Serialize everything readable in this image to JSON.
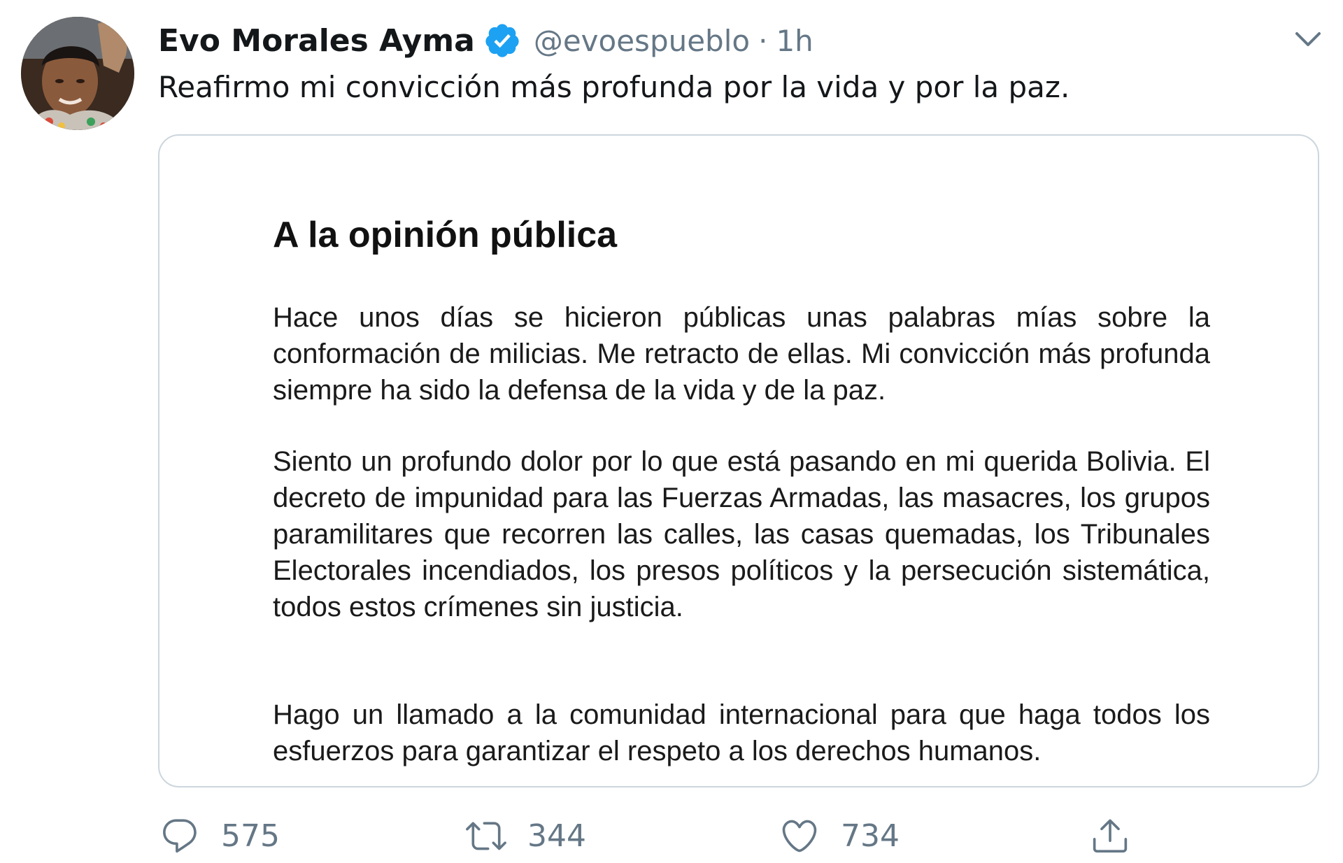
{
  "tweet": {
    "author": {
      "name": "Evo Morales Ayma",
      "handle": "@evoespueblo",
      "verified_icon": "verified-badge-icon",
      "separator": "·",
      "time": "1h"
    },
    "text": "Reafirmo mi convicción más profunda por la vida y por la paz.",
    "media": {
      "title": "A la opinión pública",
      "paragraphs": [
        "Hace unos días se hicieron públicas unas palabras mías sobre la conformación de milicias. Me retracto de ellas. Mi convicción más profunda siempre ha sido la defensa de la vida y de la paz.",
        "Siento un profundo dolor por lo que está pasando en mi querida Bolivia. El decreto de impunidad para las Fuerzas Armadas, las masacres, los grupos paramilitares que recorren las calles, las casas quemadas, los Tribunales Electorales incendiados, los presos políticos y la persecución sistemática, todos estos crímenes sin justicia.",
        "Hago un llamado a la comunidad internacional para que haga todos los  esfuerzos para garantizar el respeto a los derechos humanos."
      ]
    },
    "actions": {
      "reply": {
        "icon": "reply-icon",
        "count": "575"
      },
      "retweet": {
        "icon": "retweet-icon",
        "count": "344"
      },
      "like": {
        "icon": "heart-icon",
        "count": "734"
      },
      "share": {
        "icon": "share-icon"
      }
    },
    "menu_icon": "chevron-down-icon"
  },
  "colors": {
    "text_primary": "#14171a",
    "text_secondary": "#657786",
    "verified_blue": "#1da1f2",
    "border": "#ccd6dd"
  }
}
